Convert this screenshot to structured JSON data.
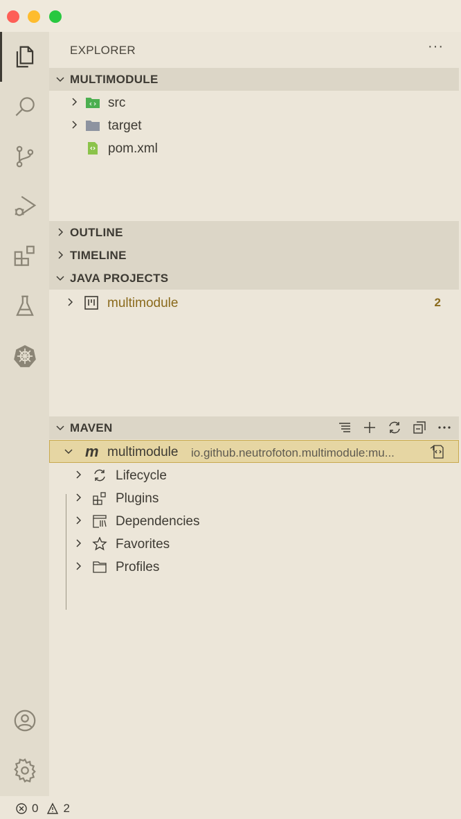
{
  "window": {
    "traffic_lights": [
      "close",
      "minimize",
      "zoom"
    ]
  },
  "activity_bar": {
    "items": [
      {
        "name": "explorer",
        "icon": "files-icon",
        "active": true
      },
      {
        "name": "search",
        "icon": "search-icon"
      },
      {
        "name": "source-control",
        "icon": "source-control-icon"
      },
      {
        "name": "run-debug",
        "icon": "run-debug-icon"
      },
      {
        "name": "extensions",
        "icon": "extensions-icon"
      },
      {
        "name": "testing",
        "icon": "beaker-icon"
      },
      {
        "name": "kubernetes",
        "icon": "kubernetes-icon"
      }
    ],
    "bottom": [
      {
        "name": "accounts",
        "icon": "account-icon"
      },
      {
        "name": "manage",
        "icon": "gear-icon"
      }
    ]
  },
  "sidebar": {
    "title": "EXPLORER",
    "more": "···",
    "sections": {
      "workspace": {
        "label": "MULTIMODULE",
        "items": [
          {
            "label": "src",
            "icon": "folder-src-icon",
            "expandable": true
          },
          {
            "label": "target",
            "icon": "folder-icon",
            "expandable": true
          },
          {
            "label": "pom.xml",
            "icon": "xml-file-icon",
            "expandable": false
          }
        ]
      },
      "outline": {
        "label": "OUTLINE"
      },
      "timeline": {
        "label": "TIMELINE"
      },
      "java_projects": {
        "label": "JAVA PROJECTS",
        "items": [
          {
            "label": "multimodule",
            "icon": "java-project-icon",
            "badge": "2"
          }
        ]
      },
      "maven": {
        "label": "MAVEN",
        "toolbar": [
          "list-flat-icon",
          "add-icon",
          "refresh-icon",
          "collapse-all-icon",
          "more-icon"
        ],
        "project": {
          "label": "multimodule",
          "description": "io.github.neutrofoton.multimodule:mu...",
          "icon": "maven-m-icon",
          "action_icon": "open-pom-icon"
        },
        "children": [
          {
            "label": "Lifecycle",
            "icon": "refresh-icon"
          },
          {
            "label": "Plugins",
            "icon": "extensions-icon"
          },
          {
            "label": "Dependencies",
            "icon": "library-icon"
          },
          {
            "label": "Favorites",
            "icon": "star-icon"
          },
          {
            "label": "Profiles",
            "icon": "folder-outline-icon"
          }
        ]
      }
    }
  },
  "status_bar": {
    "errors": "0",
    "warnings": "2"
  },
  "colors": {
    "background": "#ece6d9",
    "activity_bar": "#e2dccd",
    "section_header": "#dcd6c7",
    "selection": "#e6d6a3",
    "accent_text": "#8a6a1c",
    "src_folder": "#4caf50",
    "xml_file": "#8bc34a"
  }
}
